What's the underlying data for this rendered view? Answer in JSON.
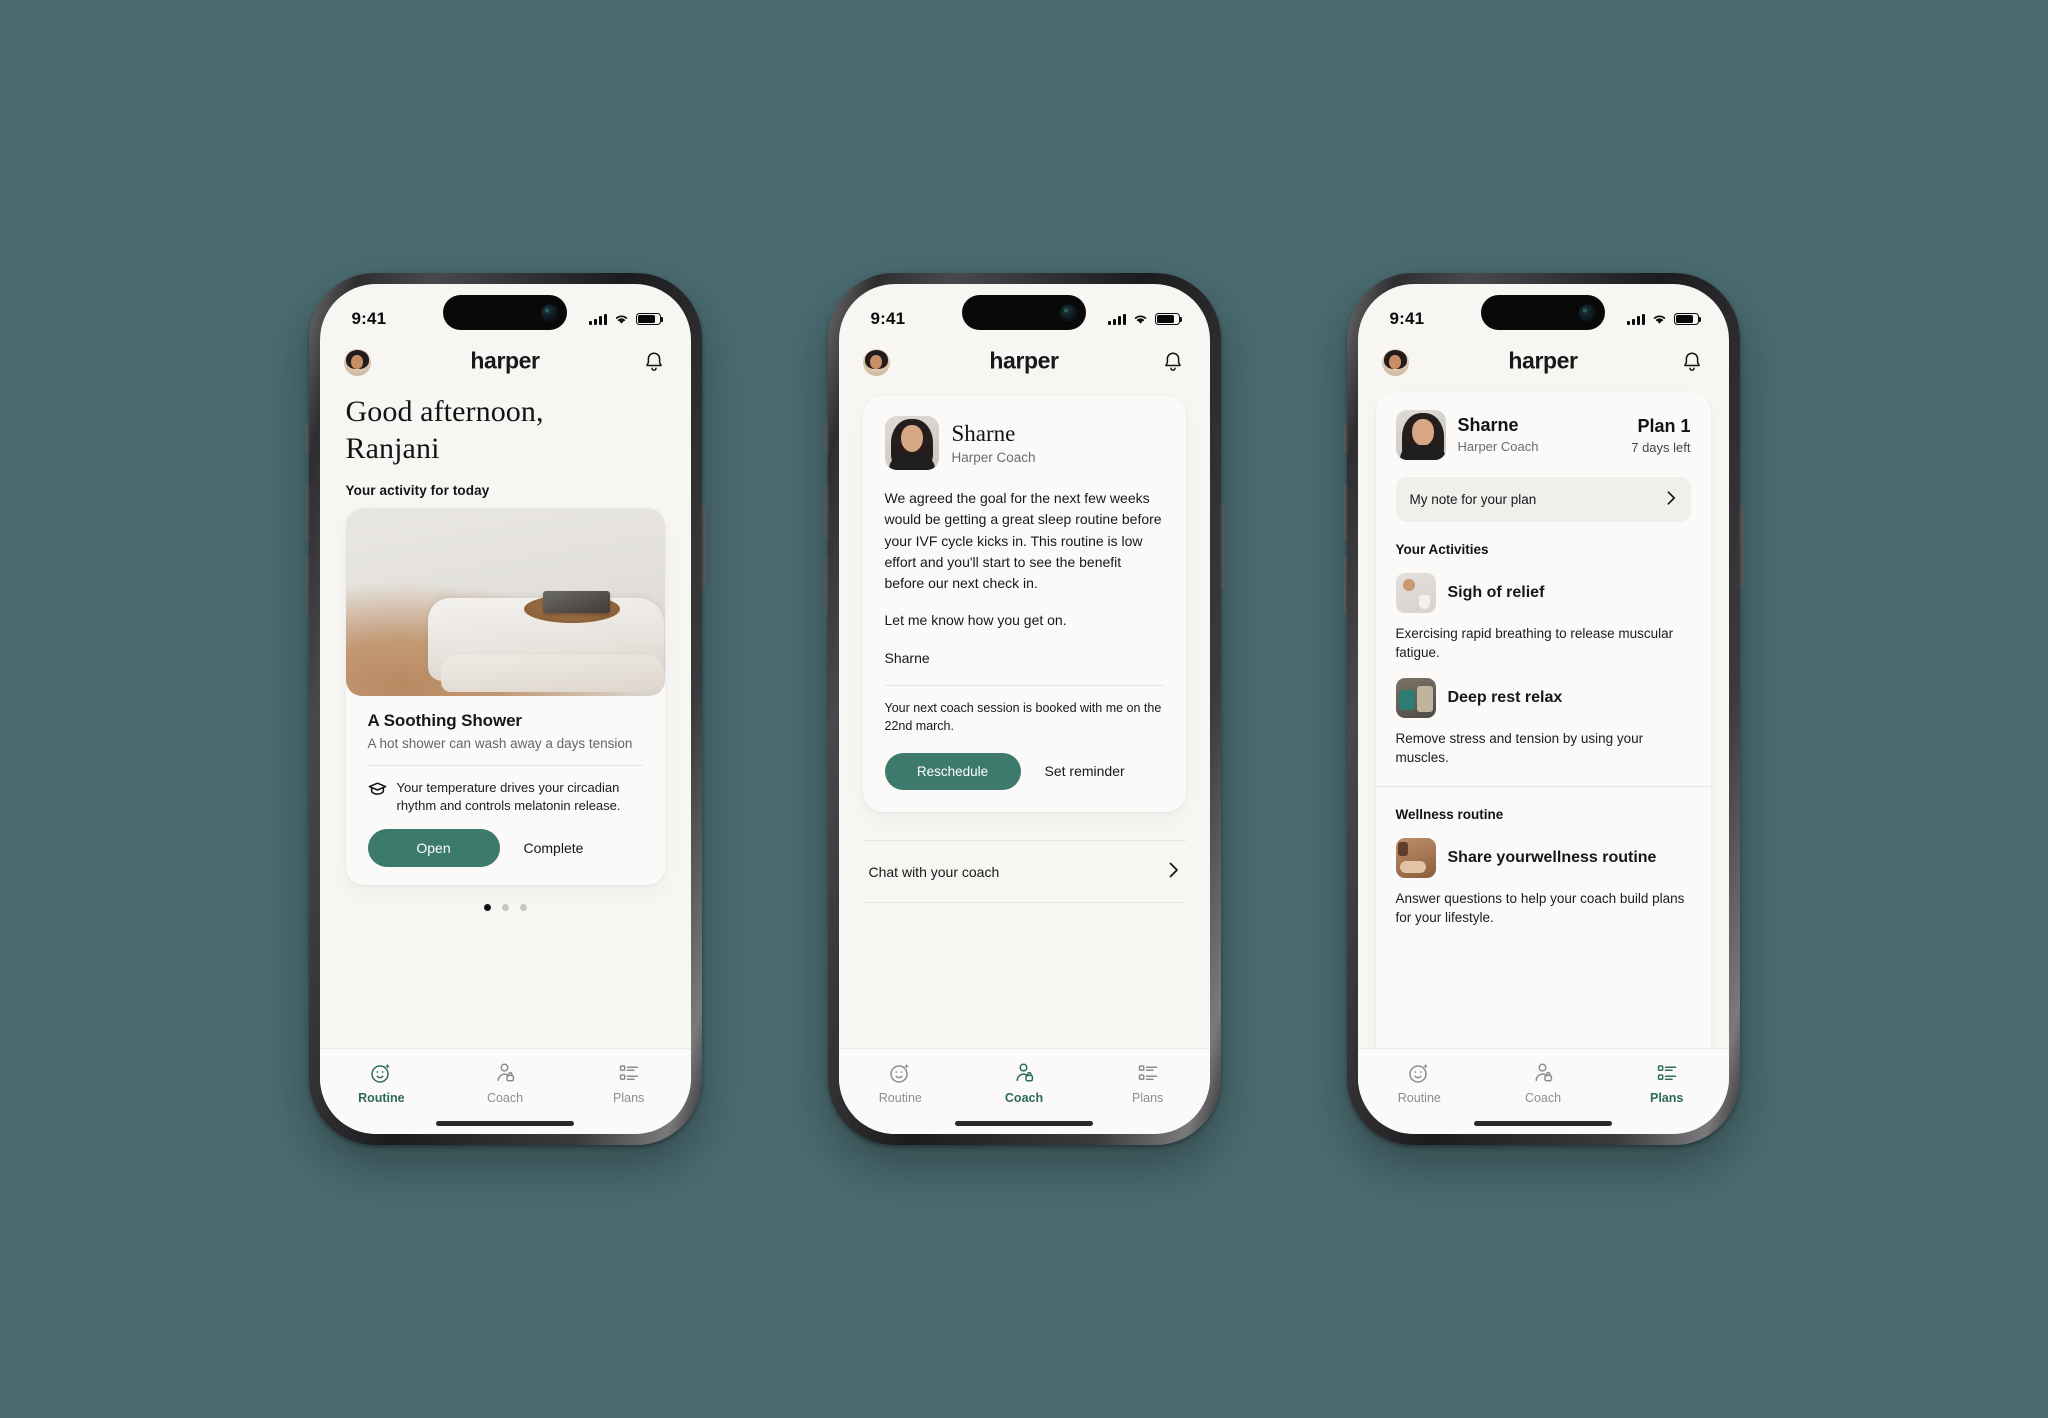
{
  "theme": {
    "background": "#4a6b70",
    "accent": "#3d7a6b",
    "tab_active": "#2d6b5e",
    "card_bg": "#fbfaf8",
    "screen_bg": "#f7f6f3",
    "text": "#16171a",
    "muted": "#6a6c70"
  },
  "status_bar": {
    "time": "9:41",
    "signal": "cellular-bars",
    "wifi": "wifi-icon",
    "battery": "battery-icon"
  },
  "brand": {
    "wordmark": "harper"
  },
  "tabs": [
    {
      "id": "routine",
      "label": "Routine",
      "icon": "smiley-sparkle-icon"
    },
    {
      "id": "coach",
      "label": "Coach",
      "icon": "person-badge-icon"
    },
    {
      "id": "plans",
      "label": "Plans",
      "icon": "list-icon"
    }
  ],
  "screen1": {
    "active_tab": "routine",
    "header": {
      "avatar": "user-avatar",
      "bell": "bell-icon"
    },
    "greeting_line1": "Good afternoon,",
    "greeting_line2": "Ranjani",
    "section_label": "Your activity for today",
    "card": {
      "image": "folded-towel-with-soap-photo",
      "title": "A Soothing Shower",
      "subtitle": "A hot shower can wash away a days tension",
      "tip_icon": "graduation-cap-icon",
      "tip": "Your temperature drives your circadian rhythm and controls melatonin release.",
      "primary_button": "Open",
      "secondary_button": "Complete"
    },
    "pagination": {
      "total": 3,
      "active_index": 0
    }
  },
  "screen2": {
    "active_tab": "coach",
    "header": {
      "avatar": "user-avatar",
      "bell": "bell-icon"
    },
    "coach": {
      "photo": "coach-headshot",
      "name": "Sharne",
      "role": "Harper Coach",
      "message_paragraphs": [
        "We agreed the goal for the next few weeks would be getting a great sleep routine before your IVF cycle kicks in. This routine is low effort and you'll start to see the benefit before our next check in.",
        "Let me know how you get on.",
        "Sharne"
      ],
      "booking_note": "Your next coach session is booked with me on the 22nd march.",
      "primary_button": "Reschedule",
      "secondary_button": "Set reminder"
    },
    "chat_row": {
      "label": "Chat with your coach",
      "icon": "chevron-right-icon"
    }
  },
  "screen3": {
    "active_tab": "plans",
    "header": {
      "avatar": "user-avatar",
      "bell": "bell-icon"
    },
    "plan": {
      "coach_photo": "coach-headshot",
      "coach_name": "Sharne",
      "coach_role": "Harper Coach",
      "plan_title": "Plan 1",
      "plan_days_left": "7 days left",
      "note_row": {
        "label": "My note for your plan",
        "icon": "chevron-right-icon"
      },
      "activities_title": "Your Activities",
      "activities": [
        {
          "thumb": "calm-shelf-photo",
          "name": "Sigh of relief",
          "description": "Exercising rapid breathing to release muscular fatigue."
        },
        {
          "thumb": "resting-person-photo",
          "name": "Deep rest relax",
          "description": "Remove stress and tension by using your muscles."
        }
      ],
      "wellness_title": "Wellness routine",
      "wellness_item": {
        "thumb": "stretching-photo",
        "name": "Share yourwellness routine",
        "description": "Answer questions to help your coach build plans for your lifestyle."
      }
    }
  }
}
